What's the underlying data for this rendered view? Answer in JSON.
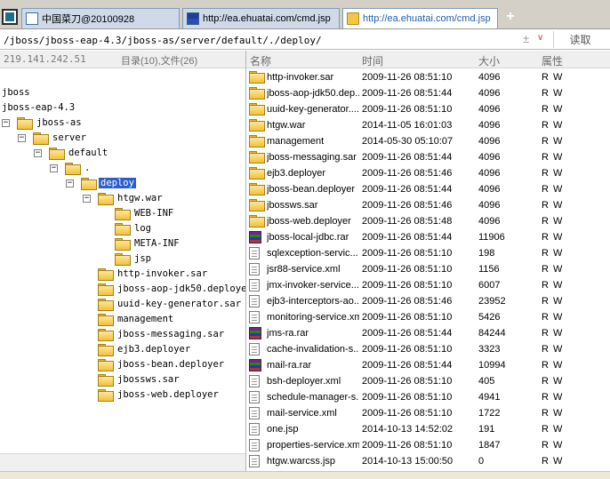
{
  "tabs": [
    {
      "label": "中国菜刀@20100928"
    },
    {
      "label": "http://ea.ehuatai.com/cmd.jsp"
    },
    {
      "label": "http://ea.ehuatai.com/cmd.jsp"
    }
  ],
  "new_tab_label": "+",
  "address": {
    "value": "/jboss/jboss-eap-4.3/jboss-as/server/default/./deploy/",
    "plus": "±",
    "dropdown": "∨",
    "go_label": "读取"
  },
  "left_header": {
    "ip": "219.141.242.51",
    "counts": "目录(10),文件(26)"
  },
  "columns": {
    "name": "名称",
    "time": "时间",
    "size": "大小",
    "attr": "属性"
  },
  "tree": [
    {
      "label": "jboss",
      "toggle": ""
    },
    {
      "label": "jboss-eap-4.3",
      "toggle": ""
    },
    {
      "label": "jboss-as",
      "toggle": "−"
    },
    {
      "label": "server",
      "toggle": "−"
    },
    {
      "label": "default",
      "toggle": "−"
    },
    {
      "label": ".",
      "toggle": "−"
    },
    {
      "label": "deploy",
      "toggle": "−"
    },
    {
      "label": "htgw.war",
      "toggle": "−"
    },
    {
      "label": "WEB-INF",
      "toggle": ""
    },
    {
      "label": "log",
      "toggle": ""
    },
    {
      "label": "META-INF",
      "toggle": ""
    },
    {
      "label": "jsp",
      "toggle": ""
    },
    {
      "label": "http-invoker.sar",
      "toggle": ""
    },
    {
      "label": "jboss-aop-jdk50.deployer",
      "toggle": ""
    },
    {
      "label": "uuid-key-generator.sar",
      "toggle": ""
    },
    {
      "label": "management",
      "toggle": ""
    },
    {
      "label": "jboss-messaging.sar",
      "toggle": ""
    },
    {
      "label": "ejb3.deployer",
      "toggle": ""
    },
    {
      "label": "jboss-bean.deployer",
      "toggle": ""
    },
    {
      "label": "jbossws.sar",
      "toggle": ""
    },
    {
      "label": "jboss-web.deployer",
      "toggle": ""
    }
  ],
  "files": [
    {
      "name": "http-invoker.sar",
      "time": "2009-11-26 08:51:10",
      "size": "4096",
      "attr": "R W",
      "icon": "folder"
    },
    {
      "name": "jboss-aop-jdk50.dep...",
      "time": "2009-11-26 08:51:44",
      "size": "4096",
      "attr": "R W",
      "icon": "folder"
    },
    {
      "name": "uuid-key-generator....",
      "time": "2009-11-26 08:51:10",
      "size": "4096",
      "attr": "R W",
      "icon": "folder"
    },
    {
      "name": "htgw.war",
      "time": "2014-11-05 16:01:03",
      "size": "4096",
      "attr": "R W",
      "icon": "folder"
    },
    {
      "name": "management",
      "time": "2014-05-30 05:10:07",
      "size": "4096",
      "attr": "R W",
      "icon": "folder"
    },
    {
      "name": "jboss-messaging.sar",
      "time": "2009-11-26 08:51:44",
      "size": "4096",
      "attr": "R W",
      "icon": "folder"
    },
    {
      "name": "ejb3.deployer",
      "time": "2009-11-26 08:51:46",
      "size": "4096",
      "attr": "R W",
      "icon": "folder"
    },
    {
      "name": "jboss-bean.deployer",
      "time": "2009-11-26 08:51:44",
      "size": "4096",
      "attr": "R W",
      "icon": "folder"
    },
    {
      "name": "jbossws.sar",
      "time": "2009-11-26 08:51:46",
      "size": "4096",
      "attr": "R W",
      "icon": "folder"
    },
    {
      "name": "jboss-web.deployer",
      "time": "2009-11-26 08:51:48",
      "size": "4096",
      "attr": "R W",
      "icon": "folder"
    },
    {
      "name": "jboss-local-jdbc.rar",
      "time": "2009-11-26 08:51:44",
      "size": "11906",
      "attr": "R W",
      "icon": "rar"
    },
    {
      "name": "sqlexception-servic...",
      "time": "2009-11-26 08:51:10",
      "size": "198",
      "attr": "R W",
      "icon": "file"
    },
    {
      "name": "jsr88-service.xml",
      "time": "2009-11-26 08:51:10",
      "size": "1156",
      "attr": "R W",
      "icon": "file"
    },
    {
      "name": "jmx-invoker-service....",
      "time": "2009-11-26 08:51:10",
      "size": "6007",
      "attr": "R W",
      "icon": "file"
    },
    {
      "name": "ejb3-interceptors-ao...",
      "time": "2009-11-26 08:51:46",
      "size": "23952",
      "attr": "R W",
      "icon": "file"
    },
    {
      "name": "monitoring-service.xml",
      "time": "2009-11-26 08:51:10",
      "size": "5426",
      "attr": "R W",
      "icon": "file"
    },
    {
      "name": "jms-ra.rar",
      "time": "2009-11-26 08:51:44",
      "size": "84244",
      "attr": "R W",
      "icon": "rar"
    },
    {
      "name": "cache-invalidation-s...",
      "time": "2009-11-26 08:51:10",
      "size": "3323",
      "attr": "R W",
      "icon": "file"
    },
    {
      "name": "mail-ra.rar",
      "time": "2009-11-26 08:51:44",
      "size": "10994",
      "attr": "R W",
      "icon": "rar"
    },
    {
      "name": "bsh-deployer.xml",
      "time": "2009-11-26 08:51:10",
      "size": "405",
      "attr": "R W",
      "icon": "file"
    },
    {
      "name": "schedule-manager-s...",
      "time": "2009-11-26 08:51:10",
      "size": "4941",
      "attr": "R W",
      "icon": "file"
    },
    {
      "name": "mail-service.xml",
      "time": "2009-11-26 08:51:10",
      "size": "1722",
      "attr": "R W",
      "icon": "file"
    },
    {
      "name": "one.jsp",
      "time": "2014-10-13 14:52:02",
      "size": "191",
      "attr": "R W",
      "icon": "file"
    },
    {
      "name": "properties-service.xml",
      "time": "2009-11-26 08:51:10",
      "size": "1847",
      "attr": "R W",
      "icon": "file"
    },
    {
      "name": "htgw.warcss.jsp",
      "time": "2014-10-13 15:00:50",
      "size": "0",
      "attr": "R W",
      "icon": "file"
    }
  ]
}
